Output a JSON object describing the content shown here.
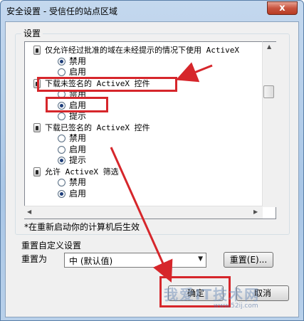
{
  "window": {
    "title": "安全设置 - 受信任的站点区域",
    "close_glyph": "x"
  },
  "settings": {
    "group_label": "设置",
    "items": [
      {
        "kind": "node",
        "text": "仅允许经过批准的域在未经提示的情况下使用 ActiveX"
      },
      {
        "kind": "option",
        "text": "禁用",
        "selected": true
      },
      {
        "kind": "option",
        "text": "启用",
        "selected": false
      },
      {
        "kind": "node",
        "text": "下载未签名的 ActiveX 控件"
      },
      {
        "kind": "option",
        "text": "禁用",
        "selected": false
      },
      {
        "kind": "option",
        "text": "启用",
        "selected": true
      },
      {
        "kind": "option",
        "text": "提示",
        "selected": false
      },
      {
        "kind": "node",
        "text": "下载已签名的 ActiveX 控件"
      },
      {
        "kind": "option",
        "text": "禁用",
        "selected": false
      },
      {
        "kind": "option",
        "text": "启用",
        "selected": false
      },
      {
        "kind": "option",
        "text": "提示",
        "selected": true
      },
      {
        "kind": "node",
        "text": "允许 ActiveX 筛选"
      },
      {
        "kind": "option",
        "text": "禁用",
        "selected": false
      },
      {
        "kind": "option",
        "text": "启用",
        "selected": true
      }
    ],
    "restart_note": "*在重新启动你的计算机后生效"
  },
  "reset": {
    "group_label": "重置自定义设置",
    "reset_to_label": "重置为",
    "selected_level": "中 (默认值)",
    "reset_button": "重置(E)..."
  },
  "buttons": {
    "ok": "确定",
    "cancel": "取消"
  },
  "watermark": {
    "main": "我爱IT技术网",
    "sub": "www.52ij.com"
  },
  "colors": {
    "annotation_red": "#d6262b",
    "title_bg": "#b8d0ea"
  }
}
